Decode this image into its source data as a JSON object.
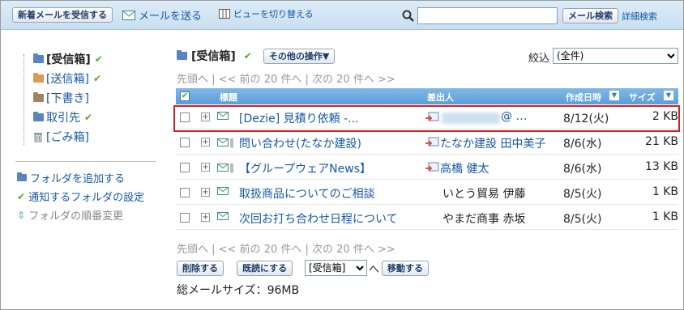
{
  "toolbar": {
    "receive_label": "新着メールを受信する",
    "send_label": "メールを送る",
    "view_label": "ビューを切り替える",
    "search_placeholder": "",
    "search_button": "メール検索",
    "advanced_search": "詳細検索"
  },
  "sidebar": {
    "folders": [
      {
        "label": "[受信箱]",
        "color": "#5a84c0",
        "bold": true,
        "check": true
      },
      {
        "label": "[送信箱]",
        "color": "#d89a5a",
        "bold": false,
        "check": true
      },
      {
        "label": "[下書き]",
        "color": "#9a8660",
        "bold": false,
        "check": false
      },
      {
        "label": "取引先",
        "color": "#5a84c0",
        "bold": false,
        "check": true
      },
      {
        "label": "[ごみ箱]",
        "color": "#8aa0a8",
        "bold": false,
        "check": false
      }
    ],
    "links": [
      {
        "label": "フォルダを追加する"
      },
      {
        "label": "通知するフォルダの設定"
      },
      {
        "label": "フォルダの順番変更"
      }
    ]
  },
  "main": {
    "folder_title": "[受信箱]",
    "other_ops": "その他の操作▼",
    "filter_label": "絞込",
    "filter_value": "(全件)",
    "pager_text": "先頭へ | << 前の 20 件へ | 次の 20 件へ >>",
    "columns": {
      "title": "標題",
      "sender": "差出人",
      "date": "作成日時",
      "size": "サイズ"
    },
    "rows": [
      {
        "subject": "[Dezie] 見積り依頼 -...",
        "sender": "@ …",
        "date": "8/12(火)",
        "size": "2 KB",
        "attach": false,
        "sender_icon": true
      },
      {
        "subject": "問い合わせ(たなか建設)",
        "sender": "たなか建設 田中美子",
        "date": "8/6(水)",
        "size": "21 KB",
        "attach": true,
        "sender_icon": true
      },
      {
        "subject": "【グループウェアNews】",
        "sender": "高橋 健太",
        "date": "8/6(水)",
        "size": "13 KB",
        "attach": true,
        "sender_icon": true
      },
      {
        "subject": "取扱商品についてのご相談",
        "sender": "いとう貿易 伊藤",
        "date": "8/5(火)",
        "size": "1 KB",
        "attach": false,
        "sender_icon": false
      },
      {
        "subject": "次回お打ち合わせ日程について",
        "sender": "やまだ商事 赤坂",
        "date": "8/5(火)",
        "size": "1 KB",
        "attach": false,
        "sender_icon": false
      }
    ],
    "delete_btn": "削除する",
    "read_btn": "既読にする",
    "move_target": "[受信箱]",
    "move_arrow": "へ",
    "move_btn": "移動する",
    "total_size": "総メールサイズ：96MB"
  }
}
